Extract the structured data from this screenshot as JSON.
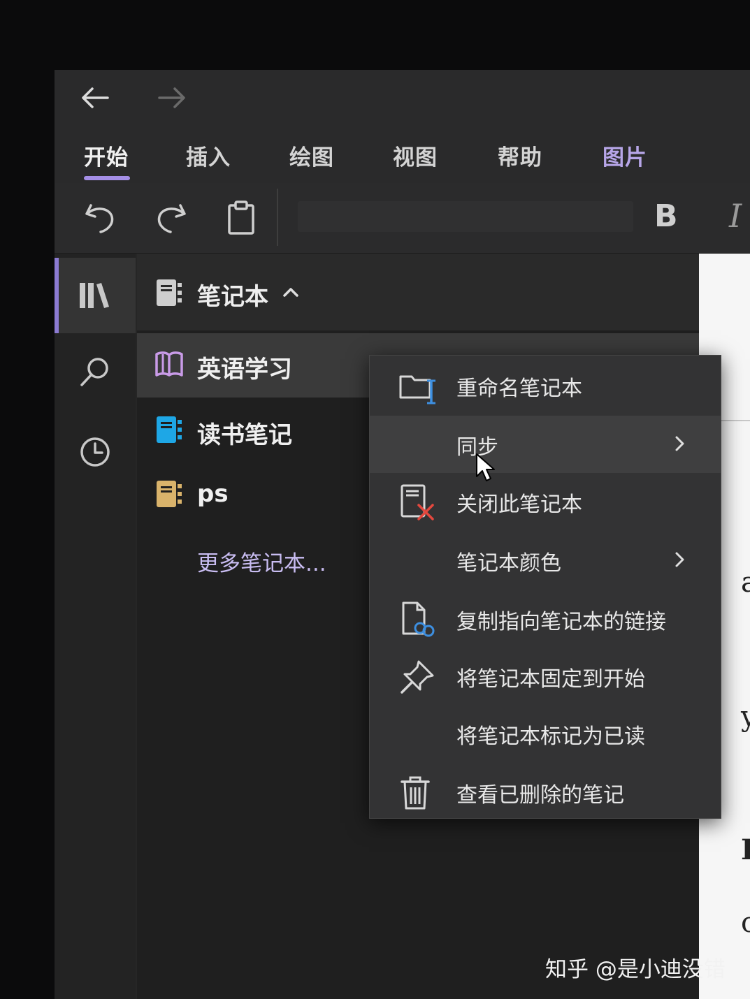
{
  "ribbon": {
    "tabs": [
      {
        "label": "开始",
        "active": true
      },
      {
        "label": "插入"
      },
      {
        "label": "绘图"
      },
      {
        "label": "视图"
      },
      {
        "label": "帮助"
      },
      {
        "label": "图片",
        "contextual": true
      }
    ],
    "bold_label": "B",
    "italic_label": "I"
  },
  "rail": {
    "items": [
      {
        "icon": "notebooks-icon",
        "active": true
      },
      {
        "icon": "search-icon"
      },
      {
        "icon": "recent-icon"
      }
    ]
  },
  "pane": {
    "header_label": "笔记本",
    "notebooks": [
      {
        "label": "英语学习",
        "color": "#c99be8",
        "selected": true
      },
      {
        "label": "读书笔记",
        "color": "#1ea7e6"
      },
      {
        "label": "ps",
        "color": "#d9b36b"
      }
    ],
    "more_label": "更多笔记本..."
  },
  "context_menu": {
    "items": [
      {
        "label": "重命名笔记本",
        "icon": "rename-icon"
      },
      {
        "label": "同步",
        "icon": "",
        "submenu": true,
        "hover": true
      },
      {
        "label": "关闭此笔记本",
        "icon": "close-notebook-icon"
      },
      {
        "label": "笔记本颜色",
        "icon": "",
        "submenu": true
      },
      {
        "label": "复制指向笔记本的链接",
        "icon": "copy-link-icon"
      },
      {
        "label": "将笔记本固定到开始",
        "icon": "pin-icon"
      },
      {
        "label": "将笔记本标记为已读",
        "icon": ""
      },
      {
        "label": "查看已删除的笔记",
        "icon": "trash-icon"
      }
    ]
  },
  "page_glyphs": [
    "a",
    "y",
    "I",
    "c"
  ],
  "watermark": "知乎 @是小迪没错",
  "colors": {
    "accent": "#a58fe6",
    "menu_bg": "#333334",
    "pane_bg": "#1f1f1f",
    "danger": "#e5483e",
    "link_blue": "#3d8fe0"
  }
}
